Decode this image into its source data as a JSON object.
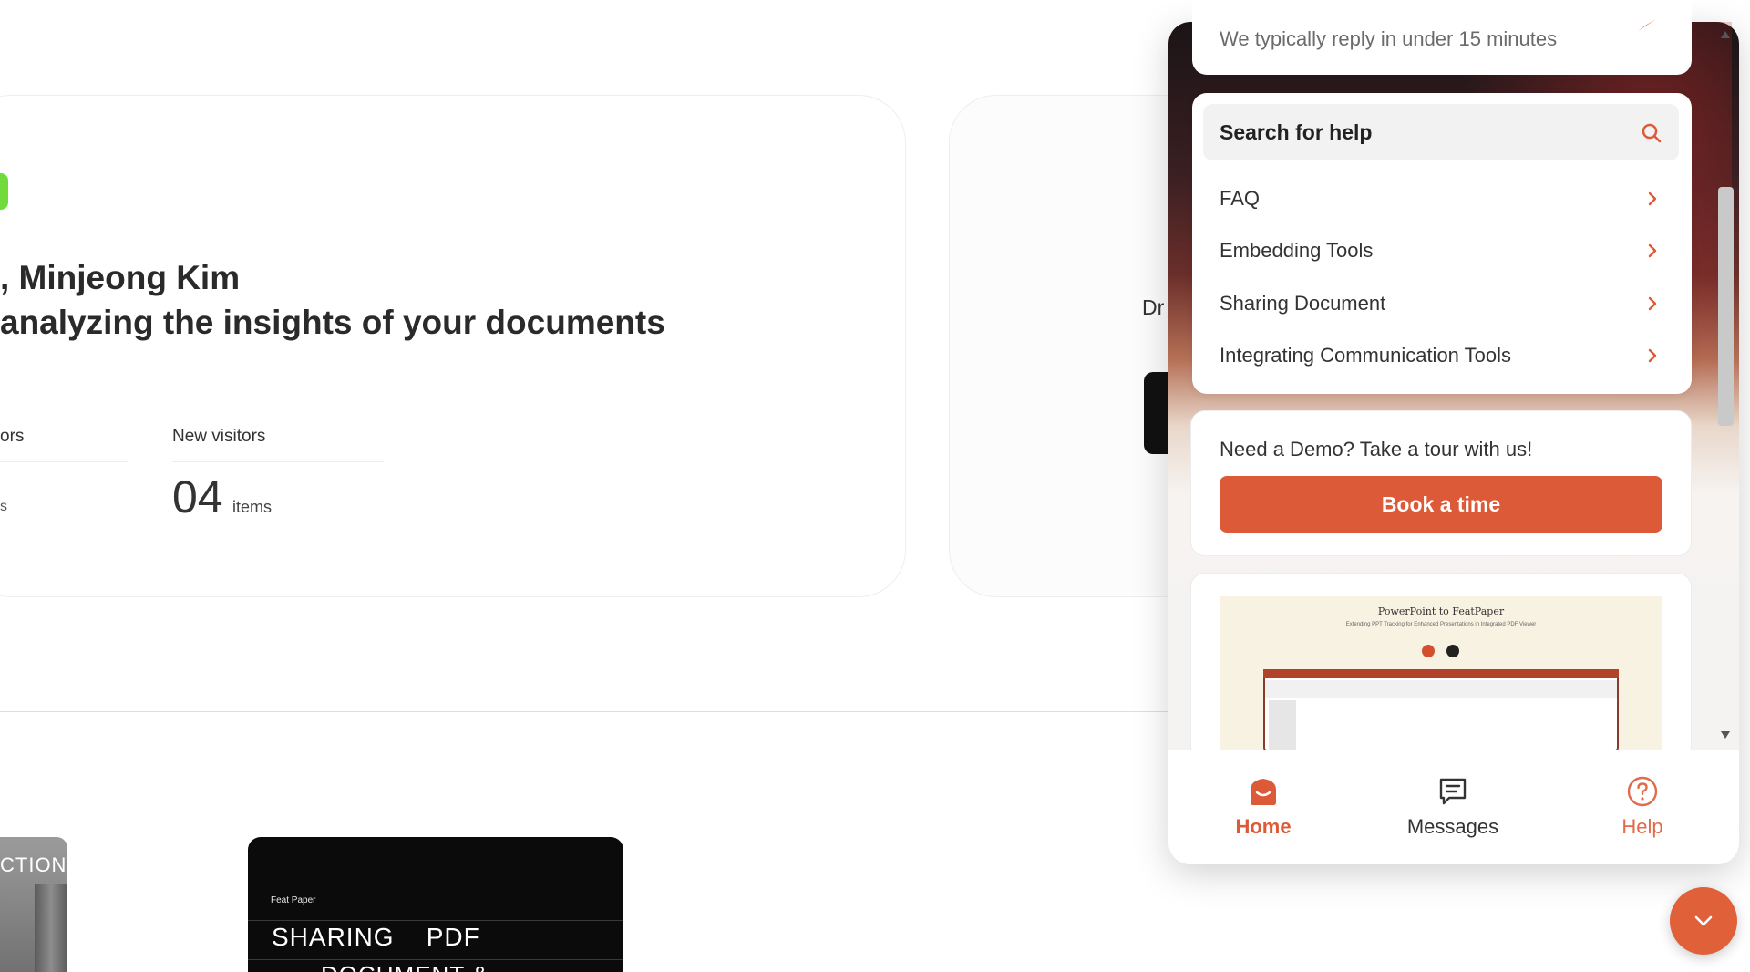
{
  "dashboard": {
    "greeting_line1": ", Minjeong Kim",
    "greeting_line2": "analyzing the insights of your documents",
    "stat_a_label_fragment": "ors",
    "stat_a_value_fragment": "s",
    "stat_b_label": "New visitors",
    "stat_b_value": "04",
    "stat_b_unit": "items",
    "right_card_text_fragment": "Dr",
    "thumb_left_text_fragment": "CTION",
    "thumb_dark_brand": "Feat Paper",
    "thumb_dark_title": "SHARING    PDF",
    "thumb_dark_subtitle_fragment": "DOCUMENT  &"
  },
  "widget": {
    "reply_note": "We typically reply in under 15 minutes",
    "search_label": "Search for help",
    "help_items": [
      {
        "label": "FAQ"
      },
      {
        "label": "Embedding Tools"
      },
      {
        "label": "Sharing Document"
      },
      {
        "label": "Integrating Communication Tools"
      }
    ],
    "demo_prompt": "Need a Demo? Take a tour with us!",
    "book_button": "Book a time",
    "video": {
      "title": "PowerPoint to FeatPaper",
      "subtitle": "Extending PPT Tracking for Enhanced Presentations in Integrated PDF Viewer"
    },
    "tabs": [
      {
        "label": "Home",
        "icon": "home-icon",
        "active": true
      },
      {
        "label": "Messages",
        "icon": "messages-icon",
        "active": false
      },
      {
        "label": "Help",
        "icon": "help-icon",
        "active": false
      }
    ],
    "launcher_icon": "chevron-down-icon"
  },
  "colors": {
    "accent": "#dd5a38",
    "green_chip": "#6fdc3c"
  }
}
